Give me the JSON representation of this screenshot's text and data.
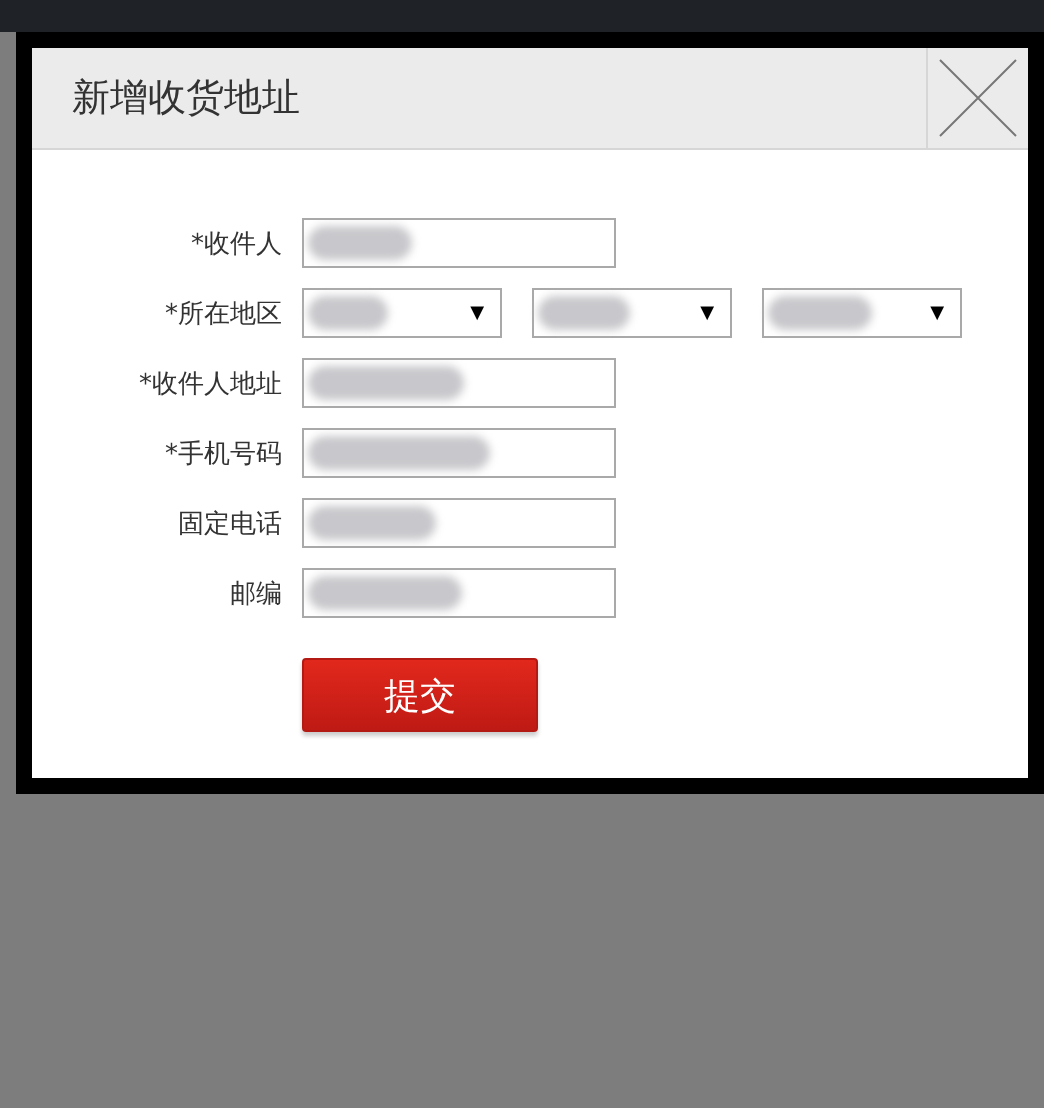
{
  "dialog": {
    "title": "新增收货地址"
  },
  "fields": [
    {
      "kind": "text",
      "label": "*收件人",
      "redacted": true
    },
    {
      "kind": "region",
      "label": "*所在地区",
      "selects": [
        {
          "redacted": true,
          "arrow": "▼"
        },
        {
          "redacted": true,
          "arrow": "▼"
        },
        {
          "redacted": true,
          "arrow": "▼"
        }
      ]
    },
    {
      "kind": "text",
      "label": "*收件人地址",
      "redacted": true
    },
    {
      "kind": "text",
      "label": "*手机号码",
      "redacted": true
    },
    {
      "kind": "text",
      "label": "固定电话",
      "redacted": true
    },
    {
      "kind": "text",
      "label": "邮编",
      "redacted": true
    }
  ],
  "submit": "提交"
}
